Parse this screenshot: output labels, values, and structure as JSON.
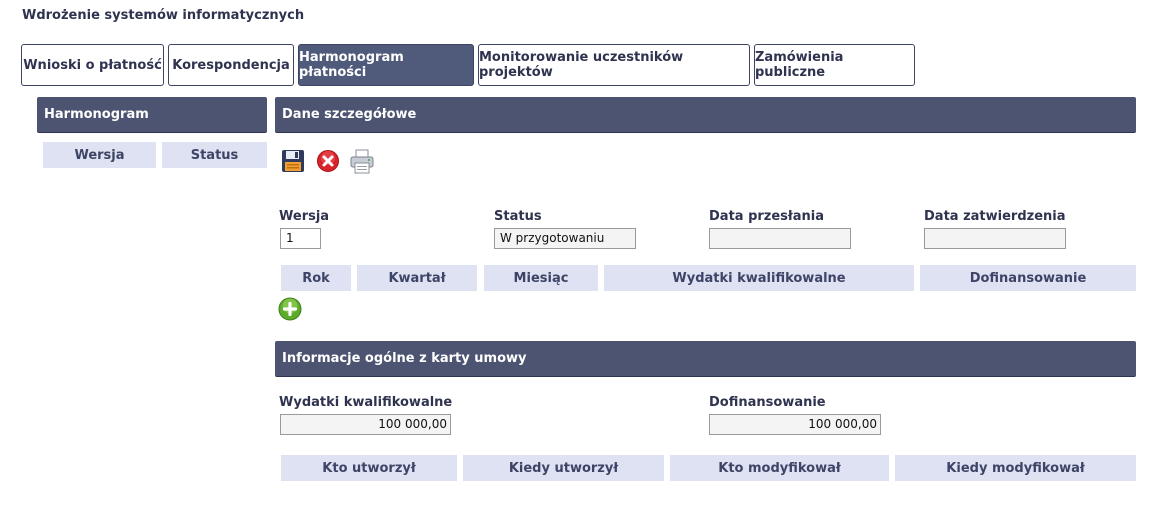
{
  "app": {
    "title": "Wdrożenie systemów informatycznych"
  },
  "tabs": [
    {
      "label": "Wnioski o płatność",
      "active": false
    },
    {
      "label": "Korespondencja",
      "active": false
    },
    {
      "label": "Harmonogram płatności",
      "active": true
    },
    {
      "label": "Monitorowanie uczestników projektów",
      "active": false
    },
    {
      "label": "Zamówienia publiczne",
      "active": false
    }
  ],
  "left_panel": {
    "title": "Harmonogram",
    "columns": [
      "Wersja",
      "Status"
    ]
  },
  "details": {
    "title": "Dane szczegółowe",
    "toolbar": {
      "save_icon": "floppy-disk-icon",
      "delete_icon": "red-x-circle-icon",
      "print_icon": "printer-icon"
    },
    "fields": {
      "wersja": {
        "label": "Wersja",
        "value": "1"
      },
      "status": {
        "label": "Status",
        "value": "W przygotowaniu"
      },
      "data_przeslania": {
        "label": "Data przesłania",
        "value": ""
      },
      "data_zatwierdzenia": {
        "label": "Data zatwierdzenia",
        "value": ""
      }
    },
    "schedule_columns": [
      "Rok",
      "Kwartał",
      "Miesiąc",
      "Wydatki kwalifikowalne",
      "Dofinansowanie"
    ],
    "add_icon": "green-plus-circle-icon"
  },
  "contract_info": {
    "title": "Informacje ogólne z karty umowy",
    "wydatki": {
      "label": "Wydatki kwalifikowalne",
      "value": "100 000,00"
    },
    "dofinansowanie": {
      "label": "Dofinansowanie",
      "value": "100 000,00"
    },
    "audit_columns": [
      "Kto utworzył",
      "Kiedy utworzył",
      "Kto modyfikował",
      "Kiedy modyfikował"
    ]
  },
  "colors": {
    "header_bg": "#4d5471",
    "tab_active_bg": "#505a7b",
    "column_header_bg": "#dfe2f2",
    "text_dark": "#2f334f"
  }
}
